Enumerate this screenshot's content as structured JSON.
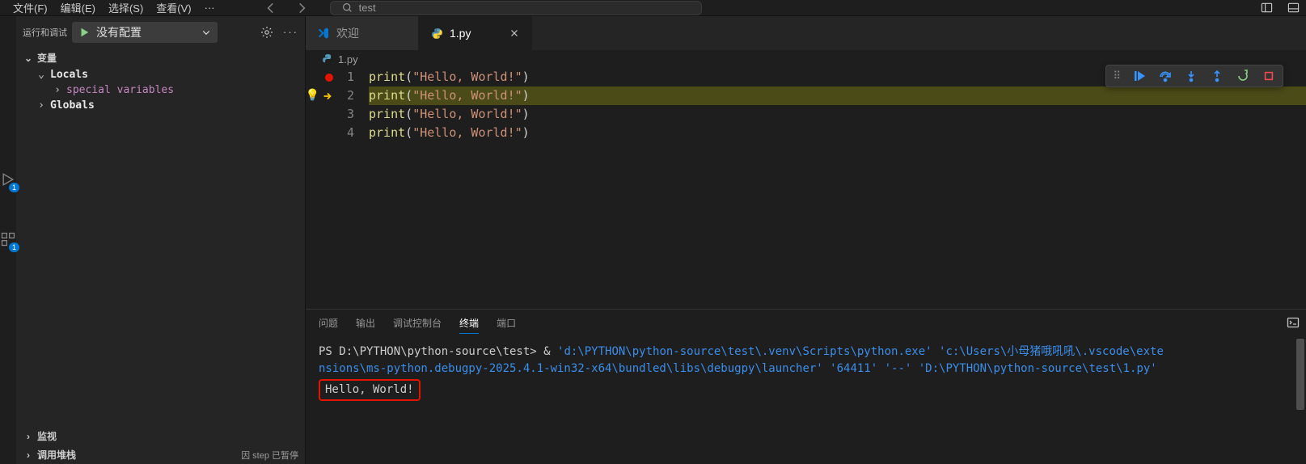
{
  "menubar": {
    "items": [
      "文件(F)",
      "编辑(E)",
      "选择(S)",
      "查看(V)"
    ],
    "more": "···",
    "search_placeholder": "test"
  },
  "sidepanel": {
    "title": "运行和调试",
    "config_label": "没有配置",
    "sections": {
      "variables": "变量",
      "locals": "Locals",
      "special": "special variables",
      "globals": "Globals",
      "watch": "监视",
      "callstack": "调用堆栈",
      "paused_status": "因 step 已暂停"
    }
  },
  "activity": {
    "badge1": "1",
    "badge2": "1"
  },
  "tabs": {
    "welcome": "欢迎",
    "file": "1.py"
  },
  "breadcrumb": {
    "file": "1.py"
  },
  "editor": {
    "lines": [
      {
        "n": "1",
        "fn": "print",
        "open": "(",
        "str": "\"Hello, World!\"",
        "close": ")",
        "bp": true,
        "current": false
      },
      {
        "n": "2",
        "fn": "print",
        "open": "(",
        "str": "\"Hello, World!\"",
        "close": ")",
        "bp": false,
        "current": true,
        "bulb": true
      },
      {
        "n": "3",
        "fn": "print",
        "open": "(",
        "str": "\"Hello, World!\"",
        "close": ")",
        "bp": false,
        "current": false
      },
      {
        "n": "4",
        "fn": "print",
        "open": "(",
        "str": "\"Hello, World!\"",
        "close": ")",
        "bp": false,
        "current": false
      }
    ]
  },
  "panel": {
    "tabs": {
      "problems": "问题",
      "output": "输出",
      "debugconsole": "调试控制台",
      "terminal": "终端",
      "ports": "端口"
    }
  },
  "terminal": {
    "prompt": "PS D:\\PYTHON\\python-source\\test>",
    "amp": "  & ",
    "cmd_part1": "'d:\\PYTHON\\python-source\\test\\.venv\\Scripts\\python.exe' 'c:\\Users\\小母猪哦吼吼\\.vscode\\exte",
    "cmd_part2": "nsions\\ms-python.debugpy-2025.4.1-win32-x64\\bundled\\libs\\debugpy\\launcher' '64411' '--' 'D:\\PYTHON\\python-source\\test\\1.py'",
    "output_line": "Hello, World!"
  }
}
